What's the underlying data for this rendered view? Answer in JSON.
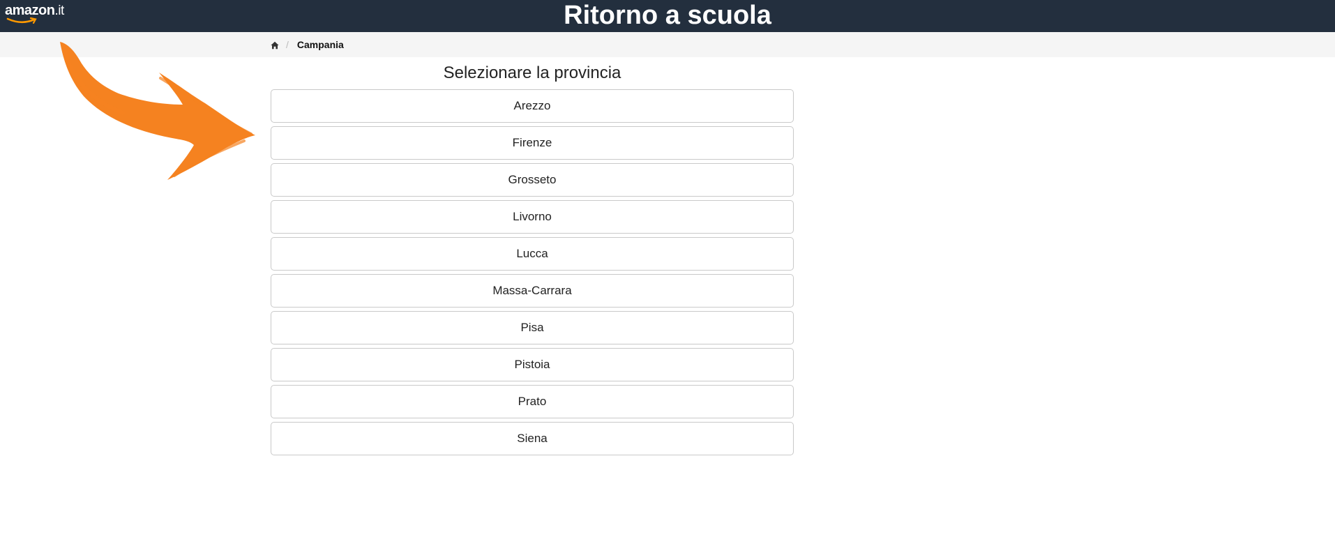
{
  "header": {
    "logo_main": "amazon",
    "logo_tld": ".it",
    "title": "Ritorno a scuola",
    "background_color": "#232f3e"
  },
  "breadcrumb": {
    "home_icon": "home-icon",
    "current": "Campania"
  },
  "main": {
    "heading": "Selezionare la provincia",
    "provinces": [
      {
        "label": "Arezzo"
      },
      {
        "label": "Firenze"
      },
      {
        "label": "Grosseto"
      },
      {
        "label": "Livorno"
      },
      {
        "label": "Lucca"
      },
      {
        "label": "Massa-Carrara"
      },
      {
        "label": "Pisa"
      },
      {
        "label": "Pistoia"
      },
      {
        "label": "Prato"
      },
      {
        "label": "Siena"
      }
    ]
  },
  "annotation": {
    "arrow_color": "#f58220",
    "arrow_icon": "brush-arrow-icon"
  }
}
